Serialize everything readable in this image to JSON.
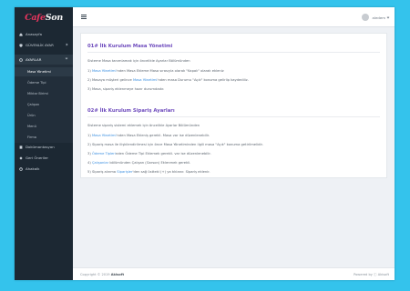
{
  "brand": {
    "logo_a": "Cafe",
    "logo_b": "Son"
  },
  "sidebar": {
    "items": [
      {
        "label": "Anasayfa",
        "icon": "home-icon"
      },
      {
        "label": "GÜVENLİK AYAR",
        "icon": "shield-icon"
      },
      {
        "label": "AYARLAR",
        "icon": "gear-icon"
      },
      {
        "label": "Dokümantasyon",
        "icon": "book-icon"
      },
      {
        "label": "Geri Öneriler",
        "icon": "feedback-icon"
      },
      {
        "label": "Ahakalk",
        "icon": "logout-icon"
      }
    ],
    "subitems": [
      "Masa Yönetimi",
      "Ödeme Tipi",
      "Miktar Birimi",
      "Çalışan",
      "Ürün",
      "Menü",
      "Firma"
    ]
  },
  "topbar": {
    "user_name": "aledem"
  },
  "section1": {
    "title": "01# İlk Kurulum Masa Yönetimi",
    "intro": "Sisteme Masa tanımlamak için öncelikle Ayarlar Bölümünden",
    "l1_a": "1) ",
    "l1_link": "Masa Yönetimi",
    "l1_b": "'nden Masa Ekleme Masa sırasıyla olarak \"Kapalı\" olarak ekleniz",
    "l2_a": "2) Masaya müşteri gelince ",
    "l2_link": "Masa Yönetimi",
    "l2_b": "'nden masa Durumu \"Açık\" konuma gelirlip kaydediliz.",
    "l3": "3) Masa, sipariş eklenmeye hazır durumdadır."
  },
  "section2": {
    "title": "02# İlk Kurulum Sipariş Ayarları",
    "intro": "Sisteme sipariş sistemi eklemek için öncelikle Ayarlar Bölümünden",
    "l1_a": "1) ",
    "l1_link": "Masa Yönetimi",
    "l1_b": "'nden Masa Ekleniş gerekli. Masa var ise düzenlenebilir.",
    "l2": "2) Sipariş masa ile ilişkilendirilmesi için önce Masa Yönetiminden ilgili masa \"Açık\" konuma getirilmelidir.",
    "l3_a": "3) ",
    "l3_link": "Ödeme Tipleri",
    "l3_b": "nden Ödeme Tipi Eklemek gerekli. var ise düzenlenebilir.",
    "l4_a": "4) ",
    "l4_link": "Çalışanlar",
    "l4_b": " bölümünden Çalışan (Garson) Eklenmek gerekli.",
    "l5_a": "5) Sipariş alınma ",
    "l5_link": "Siparişler",
    "l5_b": "'den sağ üstteki (+) ya tıklanır. Sipariş eklenir."
  },
  "footer": {
    "copyright": "Copyright © 2019",
    "company": "Akisoft",
    "powered": "Powered by ⓘ Akisoft"
  },
  "colors": {
    "sidebar": "#1c2833",
    "accent_title": "#6e4bbd",
    "link": "#3b8fe0",
    "background": "#34c3ec"
  }
}
